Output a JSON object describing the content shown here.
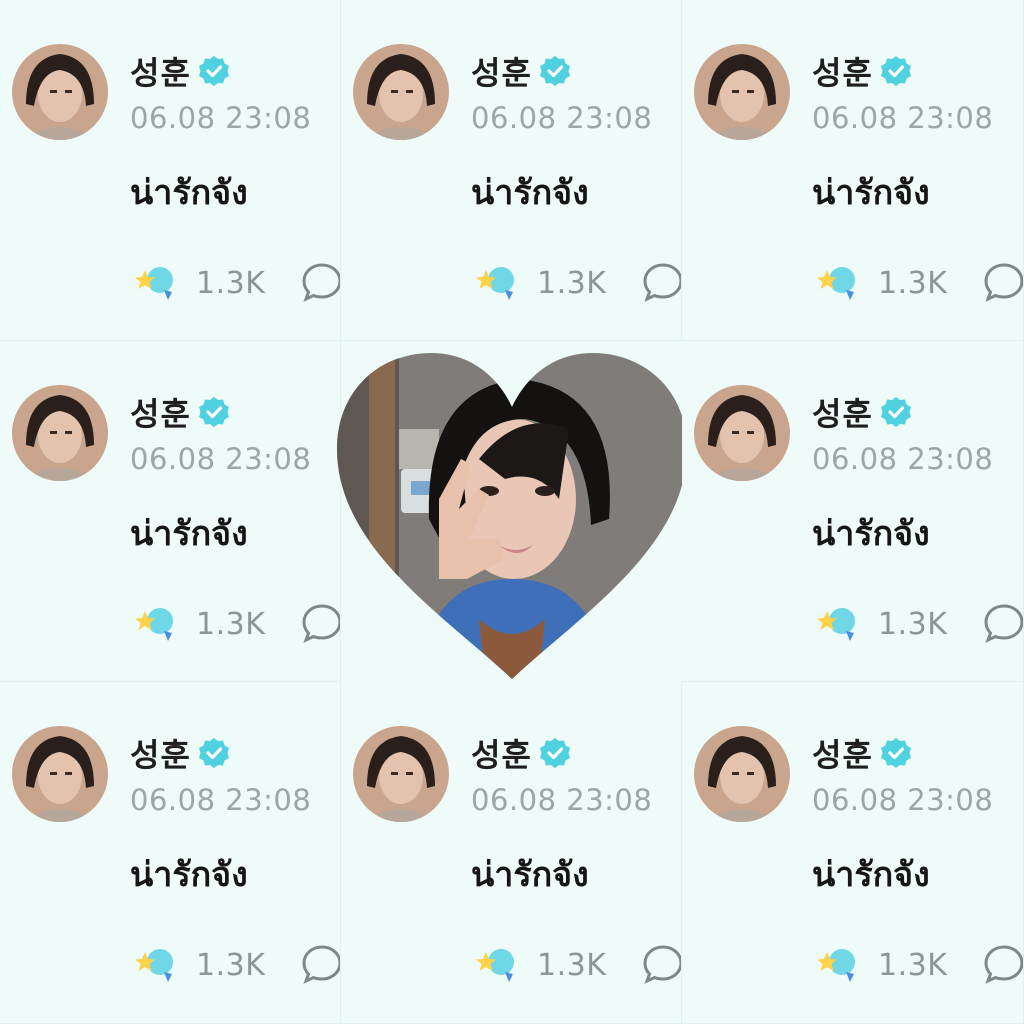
{
  "post": {
    "author": "성훈",
    "timestamp": "06.08 23:08",
    "text": "น่ารักจัง",
    "reaction_count": "1.3K"
  },
  "icons": {
    "verified": "verified-badge-icon",
    "reaction": "star-bubble-reaction-icon",
    "comment": "speech-bubble-icon"
  },
  "colors": {
    "background": "#effbf8",
    "verified": "#4fd1e0",
    "timestamp": "#9aa7a4",
    "text": "#161616"
  }
}
